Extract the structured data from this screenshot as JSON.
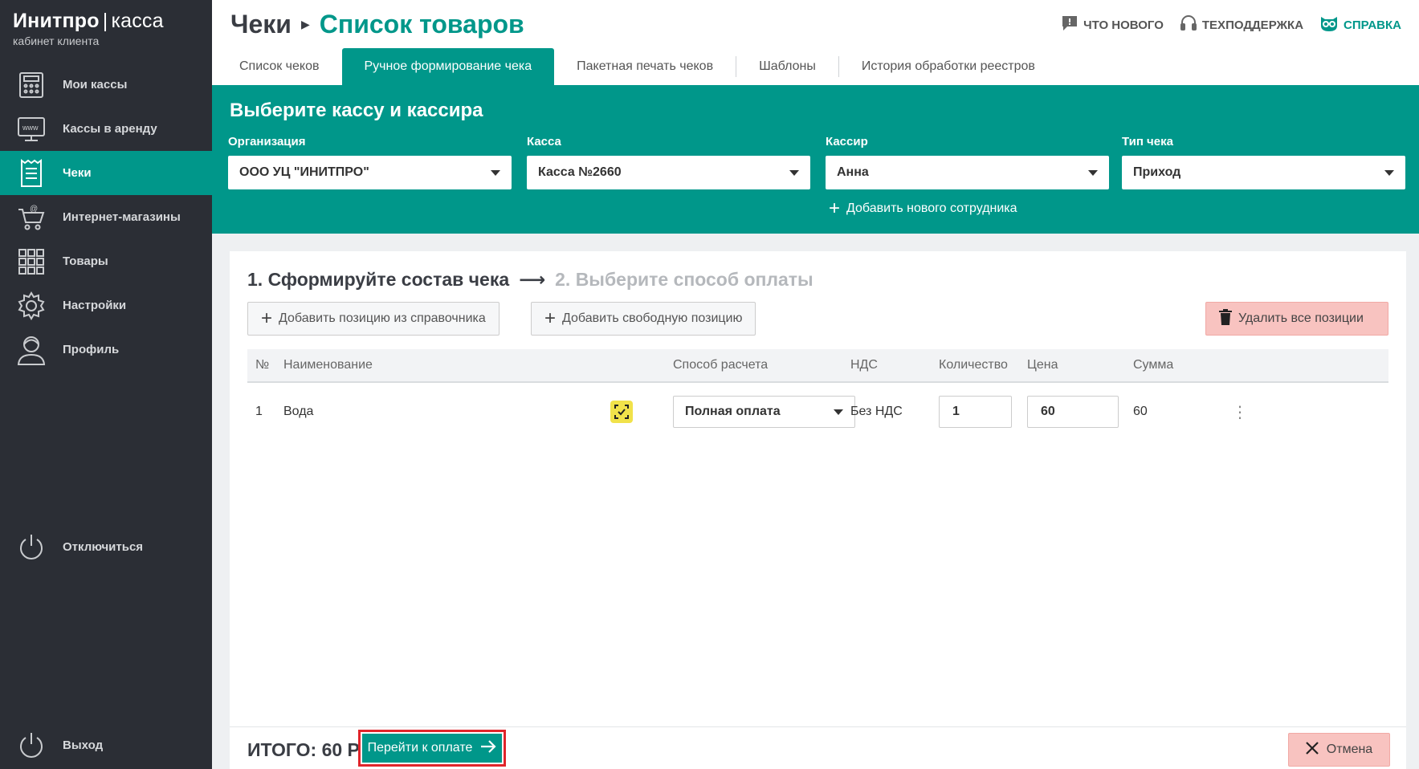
{
  "brand": {
    "name": "Инитпро",
    "product": "касса",
    "subtitle": "кабинет клиента"
  },
  "sidebar": {
    "items": [
      {
        "label": "Мои кассы",
        "icon": "cash-register-icon",
        "active": false
      },
      {
        "label": "Кассы в аренду",
        "icon": "www-monitor-icon",
        "active": false
      },
      {
        "label": "Чеки",
        "icon": "receipt-icon",
        "active": true
      },
      {
        "label": "Интернет-магазины",
        "icon": "shopping-cart-icon",
        "active": false
      },
      {
        "label": "Товары",
        "icon": "grid-icon",
        "active": false
      },
      {
        "label": "Настройки",
        "icon": "gear-icon",
        "active": false
      },
      {
        "label": "Профиль",
        "icon": "user-icon",
        "active": false
      }
    ],
    "disconnect_label": "Отключиться",
    "logout_label": "Выход"
  },
  "header": {
    "breadcrumb_root": "Чеки",
    "breadcrumb_current": "Список товаров",
    "links": {
      "whats_new": "ЧТО НОВОГО",
      "support": "ТЕХПОДДЕРЖКА",
      "help": "СПРАВКА"
    }
  },
  "tabs": [
    {
      "label": "Список чеков",
      "active": false
    },
    {
      "label": "Ручное формирование чека",
      "active": true
    },
    {
      "label": "Пакетная печать чеков",
      "active": false
    },
    {
      "label": "Шаблоны",
      "active": false
    },
    {
      "label": "История обработки реестров",
      "active": false
    }
  ],
  "select_panel": {
    "title": "Выберите кассу и кассира",
    "organization": {
      "label": "Организация",
      "value": "ООО УЦ \"ИНИТПРО\""
    },
    "register": {
      "label": "Касса",
      "value": "Касса №2660"
    },
    "cashier": {
      "label": "Кассир",
      "value": "Анна"
    },
    "receipt_type": {
      "label": "Тип чека",
      "value": "Приход"
    },
    "add_employee_label": "Добавить нового сотрудника"
  },
  "composer": {
    "step1": "1. Сформируйте состав чека",
    "step2": "2. Выберите способ оплаты",
    "add_from_catalog": "Добавить позицию из справочника",
    "add_free": "Добавить свободную позицию",
    "delete_all": "Удалить все позиции",
    "columns": {
      "num": "№",
      "name": "Наименование",
      "payment_method": "Способ расчета",
      "vat": "НДС",
      "quantity": "Количество",
      "price": "Цена",
      "sum": "Сумма"
    },
    "rows": [
      {
        "num": "1",
        "name": "Вода",
        "payment_method": "Полная оплата",
        "vat": "Без НДС",
        "quantity": "1",
        "price": "60",
        "sum": "60"
      }
    ]
  },
  "footer": {
    "total": "ИТОГО: 60 Р",
    "pay_label": "Перейти к оплате",
    "cancel_label": "Отмена"
  },
  "colors": {
    "accent": "#00978a",
    "sidebar_bg": "#2b2e35",
    "danger_bg": "#f8c3c0",
    "highlight_border": "#e0252b"
  }
}
